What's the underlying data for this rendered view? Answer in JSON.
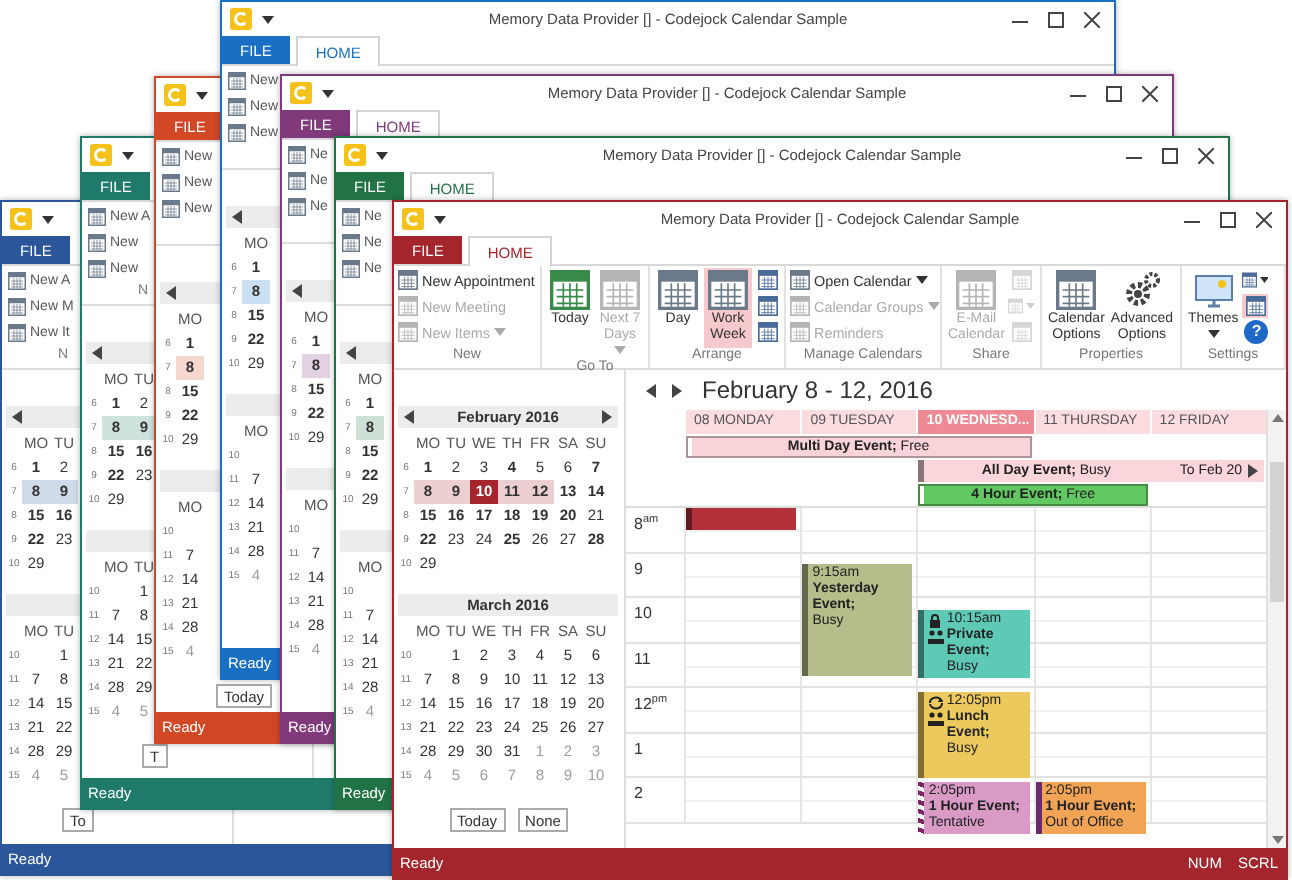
{
  "background_windows": [
    {
      "color": "#2b579a",
      "tabs": [
        {
          "label": "FILE",
          "selected": false
        }
      ],
      "ribbon_items": [
        "New A",
        "New M",
        "New It"
      ],
      "ribbon_group": "N",
      "months": [
        {
          "weekdays": [
            "MO",
            "TU"
          ],
          "weeks": [
            {
              "week": "6",
              "days": [
                {
                  "day": "1",
                  "kind": "bold"
                },
                {
                  "day": "2",
                  "kind": "plain"
                }
              ]
            },
            {
              "week": "7",
              "days": [
                {
                  "day": "8",
                  "kind": "range"
                },
                {
                  "day": "9",
                  "kind": "range"
                }
              ]
            },
            {
              "week": "8",
              "days": [
                {
                  "day": "15",
                  "kind": "bold"
                },
                {
                  "day": "16",
                  "kind": "bold"
                }
              ]
            },
            {
              "week": "9",
              "days": [
                {
                  "day": "22",
                  "kind": "bold"
                },
                {
                  "day": "23",
                  "kind": "plain"
                }
              ]
            },
            {
              "week": "10",
              "days": [
                {
                  "day": "29",
                  "kind": "plain"
                }
              ]
            }
          ]
        },
        {
          "weekdays": [
            "MO",
            "TU"
          ],
          "weeks": [
            {
              "week": "10",
              "days": [
                {
                  "kind": "blank"
                },
                {
                  "day": "1",
                  "kind": "plain"
                }
              ]
            },
            {
              "week": "11",
              "days": [
                {
                  "day": "7",
                  "kind": "plain"
                },
                {
                  "day": "8",
                  "kind": "plain"
                }
              ]
            },
            {
              "week": "12",
              "days": [
                {
                  "day": "14",
                  "kind": "plain"
                },
                {
                  "day": "15",
                  "kind": "plain"
                }
              ]
            },
            {
              "week": "13",
              "days": [
                {
                  "day": "21",
                  "kind": "plain"
                },
                {
                  "day": "22",
                  "kind": "plain"
                }
              ]
            },
            {
              "week": "14",
              "days": [
                {
                  "day": "28",
                  "kind": "plain"
                },
                {
                  "day": "29",
                  "kind": "plain"
                }
              ]
            },
            {
              "week": "15",
              "days": [
                {
                  "day": "4",
                  "kind": "other"
                },
                {
                  "day": "5",
                  "kind": "other"
                }
              ]
            }
          ]
        }
      ],
      "buttons": [
        "To"
      ],
      "status": "Ready"
    },
    {
      "color": "#1f7a6a",
      "tabs": [
        {
          "label": "FILE",
          "selected": false
        }
      ],
      "ribbon_items": [
        "New A",
        "New",
        "New"
      ],
      "ribbon_group": "N",
      "months": [
        {
          "weekdays": [
            "MO",
            "TU"
          ],
          "weeks": [
            {
              "week": "6",
              "days": [
                {
                  "day": "1",
                  "kind": "bold"
                },
                {
                  "day": "2",
                  "kind": "plain"
                }
              ]
            },
            {
              "week": "7",
              "days": [
                {
                  "day": "8",
                  "kind": "range"
                },
                {
                  "day": "9",
                  "kind": "range"
                }
              ]
            },
            {
              "week": "8",
              "days": [
                {
                  "day": "15",
                  "kind": "bold"
                },
                {
                  "day": "16",
                  "kind": "bold"
                }
              ]
            },
            {
              "week": "9",
              "days": [
                {
                  "day": "22",
                  "kind": "bold"
                },
                {
                  "day": "23",
                  "kind": "plain"
                }
              ]
            },
            {
              "week": "10",
              "days": [
                {
                  "day": "29",
                  "kind": "plain"
                }
              ]
            }
          ]
        },
        {
          "weekdays": [
            "MO",
            "TU"
          ],
          "weeks": [
            {
              "week": "10",
              "days": [
                {
                  "kind": "blank"
                },
                {
                  "day": "1",
                  "kind": "plain"
                }
              ]
            },
            {
              "week": "11",
              "days": [
                {
                  "day": "7",
                  "kind": "plain"
                },
                {
                  "day": "8",
                  "kind": "plain"
                }
              ]
            },
            {
              "week": "12",
              "days": [
                {
                  "day": "14",
                  "kind": "plain"
                },
                {
                  "day": "15",
                  "kind": "plain"
                }
              ]
            },
            {
              "week": "13",
              "days": [
                {
                  "day": "21",
                  "kind": "plain"
                },
                {
                  "day": "22",
                  "kind": "plain"
                }
              ]
            },
            {
              "week": "14",
              "days": [
                {
                  "day": "28",
                  "kind": "plain"
                },
                {
                  "day": "29",
                  "kind": "plain"
                }
              ]
            },
            {
              "week": "15",
              "days": [
                {
                  "day": "4",
                  "kind": "other"
                },
                {
                  "day": "5",
                  "kind": "other"
                }
              ]
            }
          ]
        }
      ],
      "buttons": [
        "T"
      ],
      "status": "Ready"
    },
    {
      "color": "#d24726",
      "tabs": [
        {
          "label": "FILE",
          "selected": false
        }
      ],
      "ribbon_items": [
        "New",
        "New",
        "New"
      ],
      "months": [
        {
          "weekdays": [
            "MO"
          ],
          "weeks": [
            {
              "week": "6",
              "days": [
                {
                  "day": "1",
                  "kind": "bold"
                }
              ]
            },
            {
              "week": "7",
              "days": [
                {
                  "day": "8",
                  "kind": "range"
                }
              ]
            },
            {
              "week": "8",
              "days": [
                {
                  "day": "15",
                  "kind": "bold"
                }
              ]
            },
            {
              "week": "9",
              "days": [
                {
                  "day": "22",
                  "kind": "bold"
                }
              ]
            },
            {
              "week": "10",
              "days": [
                {
                  "day": "29",
                  "kind": "plain"
                }
              ]
            }
          ]
        },
        {
          "weekdays": [
            "MO"
          ],
          "weeks": [
            {
              "week": "10",
              "days": [
                {
                  "kind": "blank"
                }
              ]
            },
            {
              "week": "11",
              "days": [
                {
                  "day": "7",
                  "kind": "plain"
                }
              ]
            },
            {
              "week": "12",
              "days": [
                {
                  "day": "14",
                  "kind": "plain"
                }
              ]
            },
            {
              "week": "13",
              "days": [
                {
                  "day": "21",
                  "kind": "plain"
                }
              ]
            },
            {
              "week": "14",
              "days": [
                {
                  "day": "28",
                  "kind": "plain"
                }
              ]
            },
            {
              "week": "15",
              "days": [
                {
                  "day": "4",
                  "kind": "other"
                }
              ]
            }
          ]
        }
      ],
      "buttons": [
        "Today"
      ],
      "status": "Ready"
    },
    {
      "color": "#1a6fc4",
      "title": "Memory Data Provider [] - Codejock Calendar Sample",
      "tabs": [
        {
          "label": "FILE",
          "selected": false
        },
        {
          "label": "HOME",
          "selected": true
        }
      ],
      "ribbon_items": [
        "New",
        "New",
        "New"
      ],
      "months": [
        {
          "weekdays": [
            "MO"
          ],
          "weeks": [
            {
              "week": "6",
              "days": [
                {
                  "day": "1",
                  "kind": "bold"
                }
              ]
            },
            {
              "week": "7",
              "days": [
                {
                  "day": "8",
                  "kind": "range"
                }
              ]
            },
            {
              "week": "8",
              "days": [
                {
                  "day": "15",
                  "kind": "bold"
                }
              ]
            },
            {
              "week": "9",
              "days": [
                {
                  "day": "22",
                  "kind": "bold"
                }
              ]
            },
            {
              "week": "10",
              "days": [
                {
                  "day": "29",
                  "kind": "plain"
                }
              ]
            }
          ]
        },
        {
          "weekdays": [
            "MO"
          ],
          "weeks": [
            {
              "week": "10",
              "days": [
                {
                  "kind": "blank"
                }
              ]
            },
            {
              "week": "11",
              "days": [
                {
                  "day": "7",
                  "kind": "plain"
                }
              ]
            },
            {
              "week": "12",
              "days": [
                {
                  "day": "14",
                  "kind": "plain"
                }
              ]
            },
            {
              "week": "13",
              "days": [
                {
                  "day": "21",
                  "kind": "plain"
                }
              ]
            },
            {
              "week": "14",
              "days": [
                {
                  "day": "28",
                  "kind": "plain"
                }
              ]
            },
            {
              "week": "15",
              "days": [
                {
                  "day": "4",
                  "kind": "other"
                }
              ]
            }
          ]
        }
      ],
      "status": "Ready"
    },
    {
      "color": "#80397b",
      "title": "Memory Data Provider [] - Codejock Calendar Sample",
      "tabs": [
        {
          "label": "FILE",
          "selected": false
        },
        {
          "label": "HOME",
          "selected": true
        }
      ],
      "ribbon_items": [
        "Ne",
        "Ne",
        "Ne"
      ],
      "months": [
        {
          "weekdays": [
            "MO"
          ],
          "weeks": [
            {
              "week": "6",
              "days": [
                {
                  "day": "1",
                  "kind": "bold"
                }
              ]
            },
            {
              "week": "7",
              "days": [
                {
                  "day": "8",
                  "kind": "range"
                }
              ]
            },
            {
              "week": "8",
              "days": [
                {
                  "day": "15",
                  "kind": "bold"
                }
              ]
            },
            {
              "week": "9",
              "days": [
                {
                  "day": "22",
                  "kind": "bold"
                }
              ]
            },
            {
              "week": "10",
              "days": [
                {
                  "day": "29",
                  "kind": "plain"
                }
              ]
            }
          ]
        },
        {
          "weekdays": [
            "MO"
          ],
          "weeks": [
            {
              "week": "10",
              "days": [
                {
                  "kind": "blank"
                }
              ]
            },
            {
              "week": "11",
              "days": [
                {
                  "day": "7",
                  "kind": "plain"
                }
              ]
            },
            {
              "week": "12",
              "days": [
                {
                  "day": "14",
                  "kind": "plain"
                }
              ]
            },
            {
              "week": "13",
              "days": [
                {
                  "day": "21",
                  "kind": "plain"
                }
              ]
            },
            {
              "week": "14",
              "days": [
                {
                  "day": "28",
                  "kind": "plain"
                }
              ]
            },
            {
              "week": "15",
              "days": [
                {
                  "day": "4",
                  "kind": "other"
                }
              ]
            }
          ]
        }
      ],
      "status": "Ready"
    },
    {
      "color": "#217346",
      "title": "Memory Data Provider [] - Codejock Calendar Sample",
      "tabs": [
        {
          "label": "FILE",
          "selected": false
        },
        {
          "label": "HOME",
          "selected": true
        }
      ],
      "ribbon_items": [
        "Ne",
        "Ne",
        "Ne"
      ],
      "months": [
        {
          "weekdays": [
            "MO"
          ],
          "weeks": [
            {
              "week": "6",
              "days": [
                {
                  "day": "1",
                  "kind": "bold"
                }
              ]
            },
            {
              "week": "7",
              "days": [
                {
                  "day": "8",
                  "kind": "range"
                }
              ]
            },
            {
              "week": "8",
              "days": [
                {
                  "day": "15",
                  "kind": "bold"
                }
              ]
            },
            {
              "week": "9",
              "days": [
                {
                  "day": "22",
                  "kind": "bold"
                }
              ]
            },
            {
              "week": "10",
              "days": [
                {
                  "day": "29",
                  "kind": "plain"
                }
              ]
            }
          ]
        },
        {
          "weekdays": [
            "MO"
          ],
          "weeks": [
            {
              "week": "10",
              "days": [
                {
                  "kind": "blank"
                }
              ]
            },
            {
              "week": "11",
              "days": [
                {
                  "day": "7",
                  "kind": "plain"
                }
              ]
            },
            {
              "week": "12",
              "days": [
                {
                  "day": "14",
                  "kind": "plain"
                }
              ]
            },
            {
              "week": "13",
              "days": [
                {
                  "day": "21",
                  "kind": "plain"
                }
              ]
            },
            {
              "week": "14",
              "days": [
                {
                  "day": "28",
                  "kind": "plain"
                }
              ]
            },
            {
              "week": "15",
              "days": [
                {
                  "day": "4",
                  "kind": "other"
                }
              ]
            }
          ]
        }
      ],
      "status": "Ready"
    }
  ],
  "main_window": {
    "color": "#a4262c",
    "title": "Memory Data Provider [] - Codejock Calendar Sample",
    "tabs": [
      {
        "label": "FILE",
        "selected": false
      },
      {
        "label": "HOME",
        "selected": true
      }
    ],
    "ribbon": [
      {
        "label": "New",
        "items": [
          {
            "kind": "small",
            "label": "New Appointment",
            "disabled": false,
            "dropdown": false
          },
          {
            "kind": "small",
            "label": "New Meeting",
            "disabled": true,
            "dropdown": false
          },
          {
            "kind": "small",
            "label": "New Items",
            "disabled": true,
            "dropdown": true
          }
        ]
      },
      {
        "label": "Go To",
        "items": [
          {
            "kind": "large",
            "label": "Today",
            "disabled": false,
            "dropdown": false
          },
          {
            "kind": "large",
            "label": "Next 7 Days",
            "disabled": true,
            "dropdown": true
          }
        ]
      },
      {
        "label": "Arrange",
        "items": [
          {
            "kind": "large",
            "label": "Day",
            "disabled": false,
            "selected": false
          },
          {
            "kind": "large",
            "label": "Work Week",
            "disabled": false,
            "selected": true
          },
          {
            "kind": "icon",
            "disabled": false,
            "selected": false
          },
          {
            "kind": "icon",
            "disabled": false,
            "selected": false
          },
          {
            "kind": "icon",
            "disabled": false,
            "selected": false
          }
        ]
      },
      {
        "label": "Manage Calendars",
        "items": [
          {
            "kind": "small",
            "label": "Open Calendar",
            "disabled": false,
            "dropdown": true
          },
          {
            "kind": "small",
            "label": "Calendar Groups",
            "disabled": true,
            "dropdown": true
          },
          {
            "kind": "small",
            "label": "Reminders",
            "disabled": true,
            "dropdown": false
          }
        ]
      },
      {
        "label": "Share",
        "items": [
          {
            "kind": "large",
            "label": "E-Mail Calendar",
            "disabled": true
          },
          {
            "kind": "icon",
            "disabled": true
          },
          {
            "kind": "icon",
            "disabled": true,
            "dropdown": true
          },
          {
            "kind": "icon",
            "disabled": true
          }
        ]
      },
      {
        "label": "Properties",
        "items": [
          {
            "kind": "large",
            "label": "Calendar Options",
            "disabled": false
          },
          {
            "kind": "large",
            "label": "Advanced Options",
            "disabled": false
          }
        ]
      },
      {
        "label": "Settings",
        "items": [
          {
            "kind": "large",
            "label": "Themes",
            "disabled": false,
            "dropdown": true,
            "selected": false
          },
          {
            "kind": "icon",
            "disabled": false,
            "dropdown": true,
            "selected": false
          },
          {
            "kind": "icon",
            "disabled": false,
            "selected": true
          },
          {
            "kind": "help",
            "label": "?",
            "disabled": false,
            "selected": false
          }
        ]
      }
    ],
    "mini_calendars": [
      {
        "title": "February 2016",
        "weekdays": [
          "MO",
          "TU",
          "WE",
          "TH",
          "FR",
          "SA",
          "SU"
        ],
        "weeks": [
          {
            "week": "6",
            "days": [
              {
                "day": "1",
                "kind": "bold"
              },
              {
                "day": "2",
                "kind": "plain"
              },
              {
                "day": "3",
                "kind": "plain"
              },
              {
                "day": "4",
                "kind": "bold"
              },
              {
                "day": "5",
                "kind": "plain"
              },
              {
                "day": "6",
                "kind": "plain"
              },
              {
                "day": "7",
                "kind": "bold"
              }
            ]
          },
          {
            "week": "7",
            "days": [
              {
                "day": "8",
                "kind": "range"
              },
              {
                "day": "9",
                "kind": "range"
              },
              {
                "day": "10",
                "kind": "today"
              },
              {
                "day": "11",
                "kind": "range"
              },
              {
                "day": "12",
                "kind": "range"
              },
              {
                "day": "13",
                "kind": "bold"
              },
              {
                "day": "14",
                "kind": "bold"
              }
            ]
          },
          {
            "week": "8",
            "days": [
              {
                "day": "15",
                "kind": "bold"
              },
              {
                "day": "16",
                "kind": "bold"
              },
              {
                "day": "17",
                "kind": "bold"
              },
              {
                "day": "18",
                "kind": "bold"
              },
              {
                "day": "19",
                "kind": "bold"
              },
              {
                "day": "20",
                "kind": "bold"
              },
              {
                "day": "21",
                "kind": "plain"
              }
            ]
          },
          {
            "week": "9",
            "days": [
              {
                "day": "22",
                "kind": "bold"
              },
              {
                "day": "23",
                "kind": "plain"
              },
              {
                "day": "24",
                "kind": "plain"
              },
              {
                "day": "25",
                "kind": "bold"
              },
              {
                "day": "26",
                "kind": "plain"
              },
              {
                "day": "27",
                "kind": "plain"
              },
              {
                "day": "28",
                "kind": "bold"
              }
            ]
          },
          {
            "week": "10",
            "days": [
              {
                "day": "29",
                "kind": "plain"
              }
            ]
          }
        ]
      },
      {
        "title": "March 2016",
        "weekdays": [
          "MO",
          "TU",
          "WE",
          "TH",
          "FR",
          "SA",
          "SU"
        ],
        "weeks": [
          {
            "week": "10",
            "days": [
              {
                "kind": "blank"
              },
              {
                "day": "1",
                "kind": "plain"
              },
              {
                "day": "2",
                "kind": "plain"
              },
              {
                "day": "3",
                "kind": "plain"
              },
              {
                "day": "4",
                "kind": "plain"
              },
              {
                "day": "5",
                "kind": "plain"
              },
              {
                "day": "6",
                "kind": "plain"
              }
            ]
          },
          {
            "week": "11",
            "days": [
              {
                "day": "7",
                "kind": "plain"
              },
              {
                "day": "8",
                "kind": "plain"
              },
              {
                "day": "9",
                "kind": "plain"
              },
              {
                "day": "10",
                "kind": "plain"
              },
              {
                "day": "11",
                "kind": "plain"
              },
              {
                "day": "12",
                "kind": "plain"
              },
              {
                "day": "13",
                "kind": "plain"
              }
            ]
          },
          {
            "week": "12",
            "days": [
              {
                "day": "14",
                "kind": "plain"
              },
              {
                "day": "15",
                "kind": "plain"
              },
              {
                "day": "16",
                "kind": "plain"
              },
              {
                "day": "17",
                "kind": "plain"
              },
              {
                "day": "18",
                "kind": "plain"
              },
              {
                "day": "19",
                "kind": "plain"
              },
              {
                "day": "20",
                "kind": "plain"
              }
            ]
          },
          {
            "week": "13",
            "days": [
              {
                "day": "21",
                "kind": "plain"
              },
              {
                "day": "22",
                "kind": "plain"
              },
              {
                "day": "23",
                "kind": "plain"
              },
              {
                "day": "24",
                "kind": "plain"
              },
              {
                "day": "25",
                "kind": "plain"
              },
              {
                "day": "26",
                "kind": "plain"
              },
              {
                "day": "27",
                "kind": "plain"
              }
            ]
          },
          {
            "week": "14",
            "days": [
              {
                "day": "28",
                "kind": "plain"
              },
              {
                "day": "29",
                "kind": "plain"
              },
              {
                "day": "30",
                "kind": "plain"
              },
              {
                "day": "31",
                "kind": "plain"
              },
              {
                "day": "1",
                "kind": "other"
              },
              {
                "day": "2",
                "kind": "other"
              },
              {
                "day": "3",
                "kind": "other"
              }
            ]
          },
          {
            "week": "15",
            "days": [
              {
                "day": "4",
                "kind": "other"
              },
              {
                "day": "5",
                "kind": "other"
              },
              {
                "day": "6",
                "kind": "other"
              },
              {
                "day": "7",
                "kind": "other"
              },
              {
                "day": "8",
                "kind": "other"
              },
              {
                "day": "9",
                "kind": "other"
              },
              {
                "day": "10",
                "kind": "other"
              }
            ]
          }
        ]
      }
    ],
    "calendar_buttons": [
      "Today",
      "None"
    ],
    "day_view": {
      "title": "February 8 - 12, 2016",
      "days": [
        {
          "label": "08 MONDAY",
          "selected": false,
          "events": [
            {
              "color": "#b3303b",
              "private": false,
              "meeting": false,
              "recurring": false
            }
          ]
        },
        {
          "label": "09 TUESDAY",
          "selected": false,
          "events": [
            {
              "time": "9:15am",
              "title": "Yesterday Event;",
              "status": "Busy",
              "color": "#b6bd8a",
              "private": false,
              "meeting": false,
              "recurring": false
            }
          ]
        },
        {
          "label": "10 WEDNESD...",
          "selected": true,
          "events": [
            {
              "time": "10:15am",
              "title": "Private Event;",
              "status": "Busy",
              "color": "#5ecab6",
              "private": true,
              "meeting": true,
              "recurring": false
            },
            {
              "time": "12:05pm",
              "title": "Lunch Event;",
              "status": "Busy",
              "color": "#ebc95c",
              "private": false,
              "meeting": true,
              "recurring": true
            },
            {
              "time": "2:05pm",
              "title": "1 Hour Event;",
              "status": "Tentative",
              "color": "#d99bc6",
              "private": false,
              "meeting": false,
              "recurring": false
            }
          ]
        },
        {
          "label": "11 THURSDAY",
          "selected": false,
          "events": [
            {
              "time": "2:05pm",
              "title": "1 Hour Event;",
              "status": "Out of Office",
              "color": "#f2a456",
              "private": false,
              "meeting": false,
              "recurring": false
            }
          ]
        },
        {
          "label": "12 FRIDAY",
          "selected": false
        }
      ],
      "all_day_events": [
        {
          "text": "**Multi Day Event;** Free",
          "color": "#f8d3d7"
        },
        {
          "text": "**All Day Event;** Busy",
          "note": "To Feb 20",
          "color": "#fad5d9"
        },
        {
          "text": "**4 Hour Event;** Free",
          "color": "#62c862"
        }
      ],
      "hours": [
        "8$^{am}$",
        "9",
        "10",
        "11",
        "12$^{pm}$",
        "1",
        "2"
      ]
    },
    "status_bar": {
      "text": "Ready",
      "indicators": [
        "NUM",
        "SCRL"
      ]
    }
  }
}
